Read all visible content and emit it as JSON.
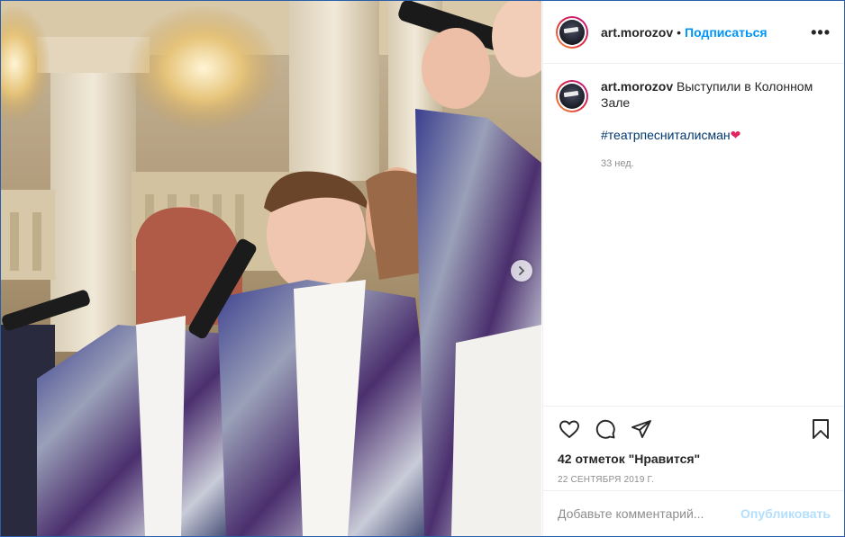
{
  "post": {
    "image_alt": "Children choir singing on stage with microphones in sequined jackets",
    "carousel_next_icon": "chevron-right-icon"
  },
  "header": {
    "username": "art.morozov",
    "separator": "•",
    "follow_label": "Подписаться",
    "more_icon": "more-horizontal-icon",
    "more_label": "•••"
  },
  "caption": {
    "username": "art.morozov",
    "text": "Выступили в Колонном Зале",
    "hashtag": "#театрпесниталисман",
    "emoji": "❤",
    "age": "33 нед."
  },
  "actions": {
    "like_icon": "heart-icon",
    "comment_icon": "comment-icon",
    "share_icon": "share-icon",
    "save_icon": "bookmark-icon",
    "likes_text": "42 отметок \"Нравится\"",
    "date": "22 СЕНТЯБРЯ 2019 Г."
  },
  "comment": {
    "placeholder": "Добавьте комментарий...",
    "publish_label": "Опубликовать"
  },
  "colors": {
    "accent": "#0095f6",
    "publish_disabled": "#b2dffc",
    "text": "#262626",
    "muted": "#8e8e8e",
    "window_border": "#2b5ea8"
  }
}
